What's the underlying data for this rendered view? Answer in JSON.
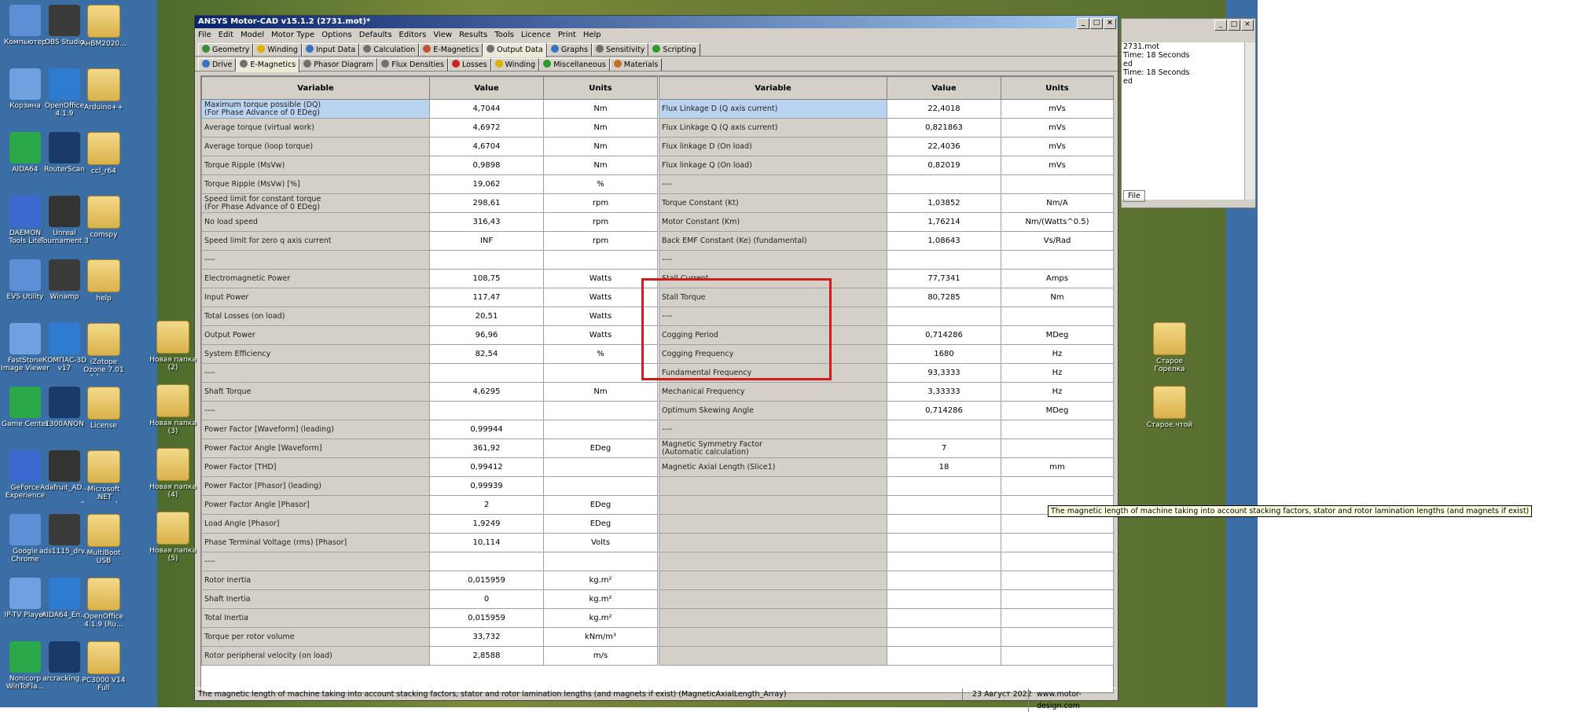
{
  "desktop": {
    "icons": [
      {
        "label": "Компьютер",
        "x": 0,
        "y": 0
      },
      {
        "label": "OBS Studio",
        "x": 1,
        "y": 0
      },
      {
        "label": "АнВМ2020...",
        "x": 2,
        "y": 0
      },
      {
        "label": "Корзина",
        "x": 0,
        "y": 1
      },
      {
        "label": "OpenOffice 4.1.9",
        "x": 1,
        "y": 1
      },
      {
        "label": "Arduino++",
        "x": 2,
        "y": 1
      },
      {
        "label": "AIDA64",
        "x": 0,
        "y": 2
      },
      {
        "label": "RouterScan",
        "x": 1,
        "y": 2
      },
      {
        "label": "ccl_r64",
        "x": 2,
        "y": 2
      },
      {
        "label": "DAEMON Tools Lite",
        "x": 0,
        "y": 3
      },
      {
        "label": "Unreal Tournament 3",
        "x": 1,
        "y": 3
      },
      {
        "label": "comspy",
        "x": 2,
        "y": 3
      },
      {
        "label": "EVS Utility",
        "x": 0,
        "y": 4
      },
      {
        "label": "Winamp",
        "x": 1,
        "y": 4
      },
      {
        "label": "help",
        "x": 2,
        "y": 4
      },
      {
        "label": "FastStone Image Viewer",
        "x": 0,
        "y": 5
      },
      {
        "label": "КОМПАС-3D v17",
        "x": 1,
        "y": 5
      },
      {
        "label": "iZotope Ozone 7.01 Advan...",
        "x": 2,
        "y": 5
      },
      {
        "label": "Game Center",
        "x": 0,
        "y": 6
      },
      {
        "label": "1300ANON",
        "x": 1,
        "y": 6
      },
      {
        "label": "License",
        "x": 2,
        "y": 6
      },
      {
        "label": "GeForce Experience",
        "x": 0,
        "y": 7
      },
      {
        "label": "Adafruit_AD...",
        "x": 1,
        "y": 7
      },
      {
        "label": "Microsoft .NET Framework...",
        "x": 2,
        "y": 7
      },
      {
        "label": "Google Chrome",
        "x": 0,
        "y": 8
      },
      {
        "label": "ads1115_drv...",
        "x": 1,
        "y": 8
      },
      {
        "label": "MultiBoot USB",
        "x": 2,
        "y": 8
      },
      {
        "label": "IP-TV Player",
        "x": 0,
        "y": 9
      },
      {
        "label": "AIDA64_En...",
        "x": 1,
        "y": 9
      },
      {
        "label": "OpenOffice 4.1.9 (Ru...",
        "x": 2,
        "y": 9
      },
      {
        "label": "Nonicorp WinToFla...",
        "x": 0,
        "y": 10
      },
      {
        "label": "arcracking...",
        "x": 1,
        "y": 10
      },
      {
        "label": "PC3000 V14 Full",
        "x": 2,
        "y": 10
      }
    ],
    "col2_icons": [
      "Новая папка (2)",
      "Новая папка (3)",
      "Новая папка (4)",
      "Новая папка (5)"
    ],
    "right_icons": [
      "Старое Горелка",
      "Старое.чтой"
    ]
  },
  "window": {
    "title": "ANSYS Motor-CAD v15.1.2 (2731.mot)*",
    "title_buttons": [
      "_",
      "□",
      "×"
    ],
    "menu": [
      "File",
      "Edit",
      "Model",
      "Motor Type",
      "Options",
      "Defaults",
      "Editors",
      "View",
      "Results",
      "Tools",
      "Licence",
      "Print",
      "Help"
    ],
    "main_tabs": [
      {
        "label": "Geometry",
        "color": "#3a8a3a"
      },
      {
        "label": "Winding",
        "color": "#e0b000"
      },
      {
        "label": "Input Data",
        "color": "#3a70c0"
      },
      {
        "label": "Calculation",
        "color": "#707070"
      },
      {
        "label": "E-Magnetics",
        "color": "#c05030"
      },
      {
        "label": "Output Data",
        "color": "#707070",
        "active": true
      },
      {
        "label": "Graphs",
        "color": "#3a70c0"
      },
      {
        "label": "Sensitivity",
        "color": "#707070"
      },
      {
        "label": "Scripting",
        "color": "#2a9a2a"
      }
    ],
    "sub_tabs": [
      {
        "label": "Drive",
        "color": "#3a70c0"
      },
      {
        "label": "E-Magnetics",
        "color": "#707070",
        "active": true
      },
      {
        "label": "Phasor Diagram",
        "color": "#707070"
      },
      {
        "label": "Flux Densities",
        "color": "#707070"
      },
      {
        "label": "Losses",
        "color": "#d02020"
      },
      {
        "label": "Winding",
        "color": "#e0b000"
      },
      {
        "label": "Miscellaneous",
        "color": "#2a9a2a"
      },
      {
        "label": "Materials",
        "color": "#c07020"
      }
    ],
    "headers": {
      "variable": "Variable",
      "value": "Value",
      "units": "Units"
    },
    "left_rows": [
      {
        "var": "Maximum torque possible (DQ)\n(For Phase Advance of 0 EDeg)",
        "val": "4,7044",
        "unit": "Nm",
        "sel": true
      },
      {
        "var": "Average torque (virtual work)",
        "val": "4,6972",
        "unit": "Nm"
      },
      {
        "var": "Average torque (loop torque)",
        "val": "4,6704",
        "unit": "Nm"
      },
      {
        "var": "Torque Ripple (MsVw)",
        "val": "0,9898",
        "unit": "Nm"
      },
      {
        "var": "Torque Ripple (MsVw) [%]",
        "val": "19,062",
        "unit": "%"
      },
      {
        "var": "Speed limit for constant torque\n(For Phase Advance of 0 EDeg)",
        "val": "298,61",
        "unit": "rpm"
      },
      {
        "var": "No load speed",
        "val": "316,43",
        "unit": "rpm"
      },
      {
        "var": "Speed limit for zero q axis current",
        "val": "INF",
        "unit": "rpm"
      },
      {
        "var": "----",
        "val": "",
        "unit": ""
      },
      {
        "var": "Electromagnetic Power",
        "val": "108,75",
        "unit": "Watts"
      },
      {
        "var": "Input Power",
        "val": "117,47",
        "unit": "Watts"
      },
      {
        "var": "Total Losses (on load)",
        "val": "20,51",
        "unit": "Watts"
      },
      {
        "var": "Output Power",
        "val": "96,96",
        "unit": "Watts"
      },
      {
        "var": "System Efficiency",
        "val": "82,54",
        "unit": "%"
      },
      {
        "var": "----",
        "val": "",
        "unit": ""
      },
      {
        "var": "Shaft Torque",
        "val": "4,6295",
        "unit": "Nm"
      },
      {
        "var": "----",
        "val": "",
        "unit": ""
      },
      {
        "var": "Power Factor [Waveform] (leading)",
        "val": "0,99944",
        "unit": ""
      },
      {
        "var": "Power Factor Angle [Waveform]",
        "val": "361,92",
        "unit": "EDeg"
      },
      {
        "var": "Power Factor [THD]",
        "val": "0,99412",
        "unit": ""
      },
      {
        "var": "Power Factor [Phasor] (leading)",
        "val": "0,99939",
        "unit": ""
      },
      {
        "var": "Power Factor Angle [Phasor]",
        "val": "2",
        "unit": "EDeg"
      },
      {
        "var": "Load Angle [Phasor]",
        "val": "1,9249",
        "unit": "EDeg"
      },
      {
        "var": "Phase Terminal Voltage (rms) [Phasor]",
        "val": "10,114",
        "unit": "Volts"
      },
      {
        "var": "----",
        "val": "",
        "unit": ""
      },
      {
        "var": "Rotor Inertia",
        "val": "0,015959",
        "unit": "kg.m²"
      },
      {
        "var": "Shaft Inertia",
        "val": "0",
        "unit": "kg.m²"
      },
      {
        "var": "Total Inertia",
        "val": "0,015959",
        "unit": "kg.m²"
      },
      {
        "var": "Torque per rotor volume",
        "val": "33,732",
        "unit": "kNm/m³"
      },
      {
        "var": "Rotor peripheral velocity (on load)",
        "val": "2,8588",
        "unit": "m/s"
      }
    ],
    "right_rows": [
      {
        "var": "Flux Linkage D (Q axis current)",
        "val": "22,4018",
        "unit": "mVs",
        "sel": true
      },
      {
        "var": "Flux Linkage Q (Q axis current)",
        "val": "0,821863",
        "unit": "mVs"
      },
      {
        "var": "Flux linkage D (On load)",
        "val": "22,4036",
        "unit": "mVs"
      },
      {
        "var": "Flux linkage Q (On load)",
        "val": "0,82019",
        "unit": "mVs"
      },
      {
        "var": "----",
        "val": "",
        "unit": ""
      },
      {
        "var": "Torque Constant (Kt)",
        "val": "1,03852",
        "unit": "Nm/A"
      },
      {
        "var": "Motor Constant (Km)",
        "val": "1,76214",
        "unit": "Nm/(Watts^0.5)"
      },
      {
        "var": "Back EMF Constant (Ke) (fundamental)",
        "val": "1,08643",
        "unit": "Vs/Rad"
      },
      {
        "var": "----",
        "val": "",
        "unit": ""
      },
      {
        "var": "Stall Current",
        "val": "77,7341",
        "unit": "Amps"
      },
      {
        "var": "Stall Torque",
        "val": "80,7285",
        "unit": "Nm"
      },
      {
        "var": "----",
        "val": "",
        "unit": ""
      },
      {
        "var": "Cogging Period",
        "val": "0,714286",
        "unit": "MDeg"
      },
      {
        "var": "Cogging Frequency",
        "val": "1680",
        "unit": "Hz"
      },
      {
        "var": "Fundamental Frequency",
        "val": "93,3333",
        "unit": "Hz"
      },
      {
        "var": "Mechanical Frequency",
        "val": "3,33333",
        "unit": "Hz"
      },
      {
        "var": "Optimum Skewing Angle",
        "val": "0,714286",
        "unit": "MDeg"
      },
      {
        "var": "----",
        "val": "",
        "unit": ""
      },
      {
        "var": "Magnetic Symmetry Factor\n(Automatic calculation)",
        "val": "7",
        "unit": ""
      },
      {
        "var": "Magnetic Axial Length (Slice1)",
        "val": "18",
        "unit": "mm"
      },
      {
        "var": "",
        "val": "",
        "unit": ""
      },
      {
        "var": "",
        "val": "",
        "unit": ""
      },
      {
        "var": "",
        "val": "",
        "unit": ""
      },
      {
        "var": "",
        "val": "",
        "unit": ""
      },
      {
        "var": "",
        "val": "",
        "unit": ""
      },
      {
        "var": "",
        "val": "",
        "unit": ""
      },
      {
        "var": "",
        "val": "",
        "unit": ""
      },
      {
        "var": "",
        "val": "",
        "unit": ""
      },
      {
        "var": "",
        "val": "",
        "unit": ""
      },
      {
        "var": "",
        "val": "",
        "unit": ""
      }
    ],
    "tooltip": "The magnetic length of machine taking into account stacking factors, stator and rotor lamination lengths (and magnets if exist)",
    "status": {
      "hint": "The magnetic length of machine taking into account stacking factors, stator and rotor lamination lengths (and magnets if exist) (MagneticAxialLength_Array)",
      "date": "23 Август 2022",
      "site": "www.motor-design.com"
    }
  },
  "side_window": {
    "lines": [
      "2731.mot",
      "Time: 18 Seconds",
      "ed",
      "Time: 18 Seconds",
      "ed"
    ],
    "button": "File",
    "title_buttons": [
      "_",
      "□",
      "×"
    ]
  }
}
